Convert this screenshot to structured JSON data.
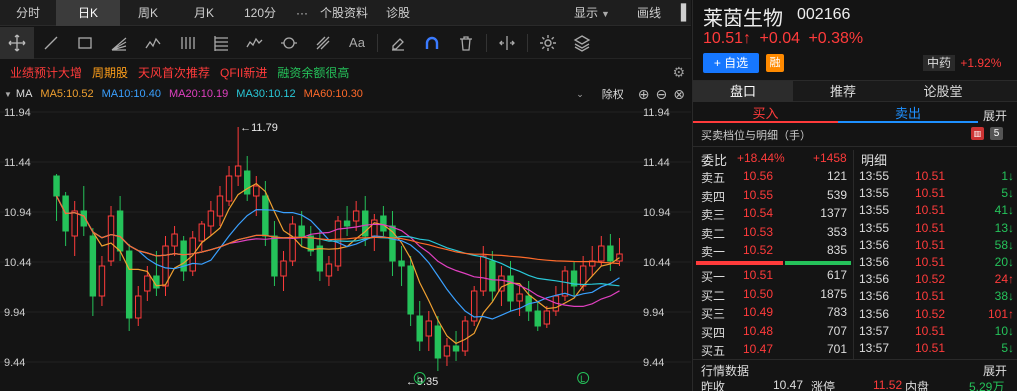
{
  "periods": [
    {
      "label": "分时",
      "active": false
    },
    {
      "label": "日K",
      "active": true
    },
    {
      "label": "周K",
      "active": false
    },
    {
      "label": "月K",
      "active": false
    },
    {
      "label": "120分",
      "active": false
    },
    {
      "label": "···",
      "active": false
    },
    {
      "label": "个股资料",
      "active": false
    },
    {
      "label": "诊股",
      "active": false
    }
  ],
  "display_label": "显示",
  "draw_label": "画线",
  "tags": [
    "业绩预计大增",
    "周期股",
    "天风首次推荐",
    "QFII新进",
    "融资余额很高"
  ],
  "ma": {
    "label": "MA",
    "items": [
      {
        "label": "MA5:10.52",
        "color": "#f0a030"
      },
      {
        "label": "MA10:10.40",
        "color": "#3aa0ff"
      },
      {
        "label": "MA20:10.19",
        "color": "#e040c0"
      },
      {
        "label": "MA30:10.12",
        "color": "#29c8d8"
      },
      {
        "label": "MA60:10.30",
        "color": "#ff6a2a"
      }
    ],
    "adjust_label": "除权"
  },
  "chart_data": {
    "type": "candlestick",
    "y_ticks": [
      "11.94",
      "11.44",
      "10.94",
      "10.44",
      "9.94",
      "9.44"
    ],
    "ylim": [
      9.44,
      11.94
    ],
    "high_marker": "←11.79",
    "low_marker": "←9.35",
    "markers": [
      "L",
      "L"
    ],
    "candles": [
      [
        11.3,
        11.32,
        10.85,
        11.1
      ],
      [
        11.1,
        11.14,
        10.6,
        10.75
      ],
      [
        10.7,
        11.05,
        10.5,
        10.95
      ],
      [
        10.95,
        11.2,
        10.7,
        10.8
      ],
      [
        10.7,
        10.78,
        9.9,
        10.1
      ],
      [
        10.1,
        10.5,
        10.0,
        10.4
      ],
      [
        10.45,
        11.0,
        10.4,
        10.9
      ],
      [
        10.95,
        11.1,
        10.45,
        10.55
      ],
      [
        10.55,
        10.62,
        9.75,
        9.88
      ],
      [
        9.88,
        10.2,
        9.8,
        10.1
      ],
      [
        10.15,
        10.4,
        10.05,
        10.3
      ],
      [
        10.3,
        10.55,
        10.1,
        10.18
      ],
      [
        10.2,
        10.7,
        10.1,
        10.6
      ],
      [
        10.6,
        10.8,
        10.5,
        10.72
      ],
      [
        10.65,
        10.7,
        10.25,
        10.35
      ],
      [
        10.35,
        10.75,
        10.3,
        10.68
      ],
      [
        10.65,
        10.85,
        10.55,
        10.82
      ],
      [
        10.8,
        11.05,
        10.7,
        10.95
      ],
      [
        10.9,
        11.2,
        10.8,
        11.1
      ],
      [
        11.05,
        11.4,
        11.0,
        11.3
      ],
      [
        11.3,
        11.79,
        11.2,
        11.4
      ],
      [
        11.35,
        11.5,
        11.05,
        11.12
      ],
      [
        11.1,
        11.3,
        10.9,
        11.2
      ],
      [
        11.1,
        11.25,
        10.6,
        10.7
      ],
      [
        10.7,
        10.85,
        10.2,
        10.3
      ],
      [
        10.3,
        10.55,
        10.15,
        10.45
      ],
      [
        10.45,
        10.9,
        10.4,
        10.82
      ],
      [
        10.8,
        10.95,
        10.6,
        10.7
      ],
      [
        10.7,
        10.8,
        10.5,
        10.55
      ],
      [
        10.6,
        10.75,
        10.25,
        10.35
      ],
      [
        10.3,
        10.5,
        10.2,
        10.42
      ],
      [
        10.4,
        10.9,
        10.35,
        10.85
      ],
      [
        10.85,
        11.0,
        10.7,
        10.8
      ],
      [
        10.85,
        11.05,
        10.75,
        10.95
      ],
      [
        10.95,
        11.1,
        10.6,
        10.7
      ],
      [
        10.7,
        10.92,
        10.55,
        10.86
      ],
      [
        10.9,
        11.0,
        10.7,
        10.75
      ],
      [
        10.8,
        10.95,
        10.3,
        10.45
      ],
      [
        10.45,
        10.6,
        10.2,
        10.4
      ],
      [
        10.4,
        10.5,
        9.8,
        9.92
      ],
      [
        9.9,
        10.05,
        9.55,
        9.65
      ],
      [
        9.7,
        9.95,
        9.55,
        9.85
      ],
      [
        9.8,
        9.9,
        9.35,
        9.48
      ],
      [
        9.5,
        9.68,
        9.4,
        9.6
      ],
      [
        9.6,
        9.75,
        9.45,
        9.55
      ],
      [
        9.55,
        9.9,
        9.5,
        9.85
      ],
      [
        9.85,
        10.2,
        9.8,
        10.15
      ],
      [
        10.15,
        10.6,
        10.1,
        10.5
      ],
      [
        10.45,
        10.55,
        10.05,
        10.15
      ],
      [
        10.15,
        10.4,
        10.0,
        10.3
      ],
      [
        10.3,
        10.45,
        9.95,
        10.05
      ],
      [
        10.05,
        10.2,
        9.9,
        10.12
      ],
      [
        10.1,
        10.25,
        9.85,
        9.95
      ],
      [
        9.95,
        10.05,
        9.75,
        9.8
      ],
      [
        9.82,
        10.0,
        9.78,
        9.95
      ],
      [
        9.95,
        10.2,
        9.9,
        10.1
      ],
      [
        10.1,
        10.4,
        10.05,
        10.35
      ],
      [
        10.35,
        10.45,
        10.1,
        10.2
      ],
      [
        10.2,
        10.5,
        10.15,
        10.4
      ],
      [
        10.4,
        10.6,
        10.3,
        10.45
      ],
      [
        10.45,
        10.7,
        10.4,
        10.6
      ],
      [
        10.6,
        10.72,
        10.35,
        10.45
      ],
      [
        10.45,
        10.68,
        10.4,
        10.52
      ]
    ]
  },
  "stock": {
    "name": "莱茵生物",
    "code": "002166",
    "price": "10.51↑",
    "change": "+0.04",
    "change_pct": "+0.38%",
    "add_watch": "+ 自选",
    "margin_badge": "融",
    "sector": "中药",
    "sector_pct": "+1.92%"
  },
  "tabs": [
    "盘口",
    "推荐",
    "论股堂"
  ],
  "buy_label": "买入",
  "sell_label": "卖出",
  "expand_label": "展开",
  "book_title": "买卖档位与明细（手）",
  "book_count": "5",
  "ratio": {
    "label": "委比",
    "pct": "+18.44%",
    "diff": "+1458"
  },
  "detail_label": "明细",
  "asks": [
    {
      "label": "卖五",
      "price": "10.56",
      "vol": "121"
    },
    {
      "label": "卖四",
      "price": "10.55",
      "vol": "539"
    },
    {
      "label": "卖三",
      "price": "10.54",
      "vol": "1377"
    },
    {
      "label": "卖二",
      "price": "10.53",
      "vol": "353"
    },
    {
      "label": "卖一",
      "price": "10.52",
      "vol": "835"
    }
  ],
  "bids": [
    {
      "label": "买一",
      "price": "10.51",
      "vol": "617"
    },
    {
      "label": "买二",
      "price": "10.50",
      "vol": "1875"
    },
    {
      "label": "买三",
      "price": "10.49",
      "vol": "783"
    },
    {
      "label": "买四",
      "price": "10.48",
      "vol": "707"
    },
    {
      "label": "买五",
      "price": "10.47",
      "vol": "701"
    }
  ],
  "ticks": [
    {
      "time": "13:55",
      "price": "10.51",
      "vol": "1↓",
      "dir": "down"
    },
    {
      "time": "13:55",
      "price": "10.51",
      "vol": "5↓",
      "dir": "down"
    },
    {
      "time": "13:55",
      "price": "10.51",
      "vol": "41↓",
      "dir": "down"
    },
    {
      "time": "13:55",
      "price": "10.51",
      "vol": "13↓",
      "dir": "down"
    },
    {
      "time": "13:56",
      "price": "10.51",
      "vol": "58↓",
      "dir": "down"
    },
    {
      "time": "13:56",
      "price": "10.51",
      "vol": "20↓",
      "dir": "down"
    },
    {
      "time": "13:56",
      "price": "10.52",
      "vol": "24↑",
      "dir": "up"
    },
    {
      "time": "13:56",
      "price": "10.51",
      "vol": "38↓",
      "dir": "down"
    },
    {
      "time": "13:56",
      "price": "10.52",
      "vol": "101↑",
      "dir": "up"
    },
    {
      "time": "13:57",
      "price": "10.51",
      "vol": "10↓",
      "dir": "down"
    },
    {
      "time": "13:57",
      "price": "10.51",
      "vol": "5↓",
      "dir": "down"
    }
  ],
  "market_title": "行情数据",
  "market_expand": "展开",
  "market_row": [
    {
      "label": "昨收",
      "value": "10.47"
    },
    {
      "label": "涨停",
      "value": "11.52"
    },
    {
      "label": "内盘",
      "value": "5.29万"
    }
  ],
  "colors": {
    "up": "#ff3b3b",
    "down": "#25c25a",
    "accent": "#1677ff",
    "badge": "#ff8a00"
  }
}
